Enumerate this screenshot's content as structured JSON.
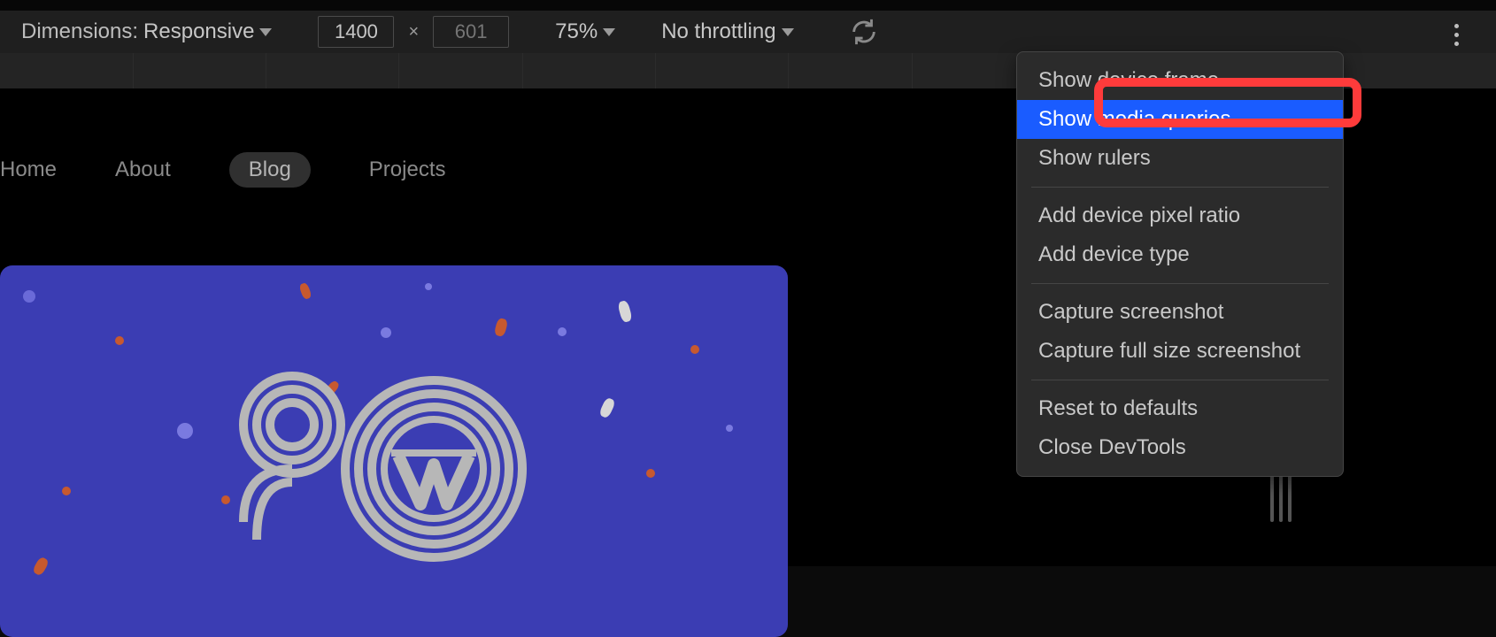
{
  "toolbar": {
    "dimensions_label": "Dimensions:",
    "device_preset": "Responsive",
    "width_value": "1400",
    "height_placeholder": "601",
    "zoom": "75%",
    "throttling": "No throttling"
  },
  "nav": {
    "item0": "Home",
    "item1": "About",
    "item2": "Blog",
    "item3": "Projects"
  },
  "menu": {
    "show_device_frame": "Show device frame",
    "show_media_queries": "Show media queries",
    "show_rulers": "Show rulers",
    "add_device_pixel_ratio": "Add device pixel ratio",
    "add_device_type": "Add device type",
    "capture_screenshot": "Capture screenshot",
    "capture_full_screenshot": "Capture full size screenshot",
    "reset_defaults": "Reset to defaults",
    "close_devtools": "Close DevTools"
  }
}
